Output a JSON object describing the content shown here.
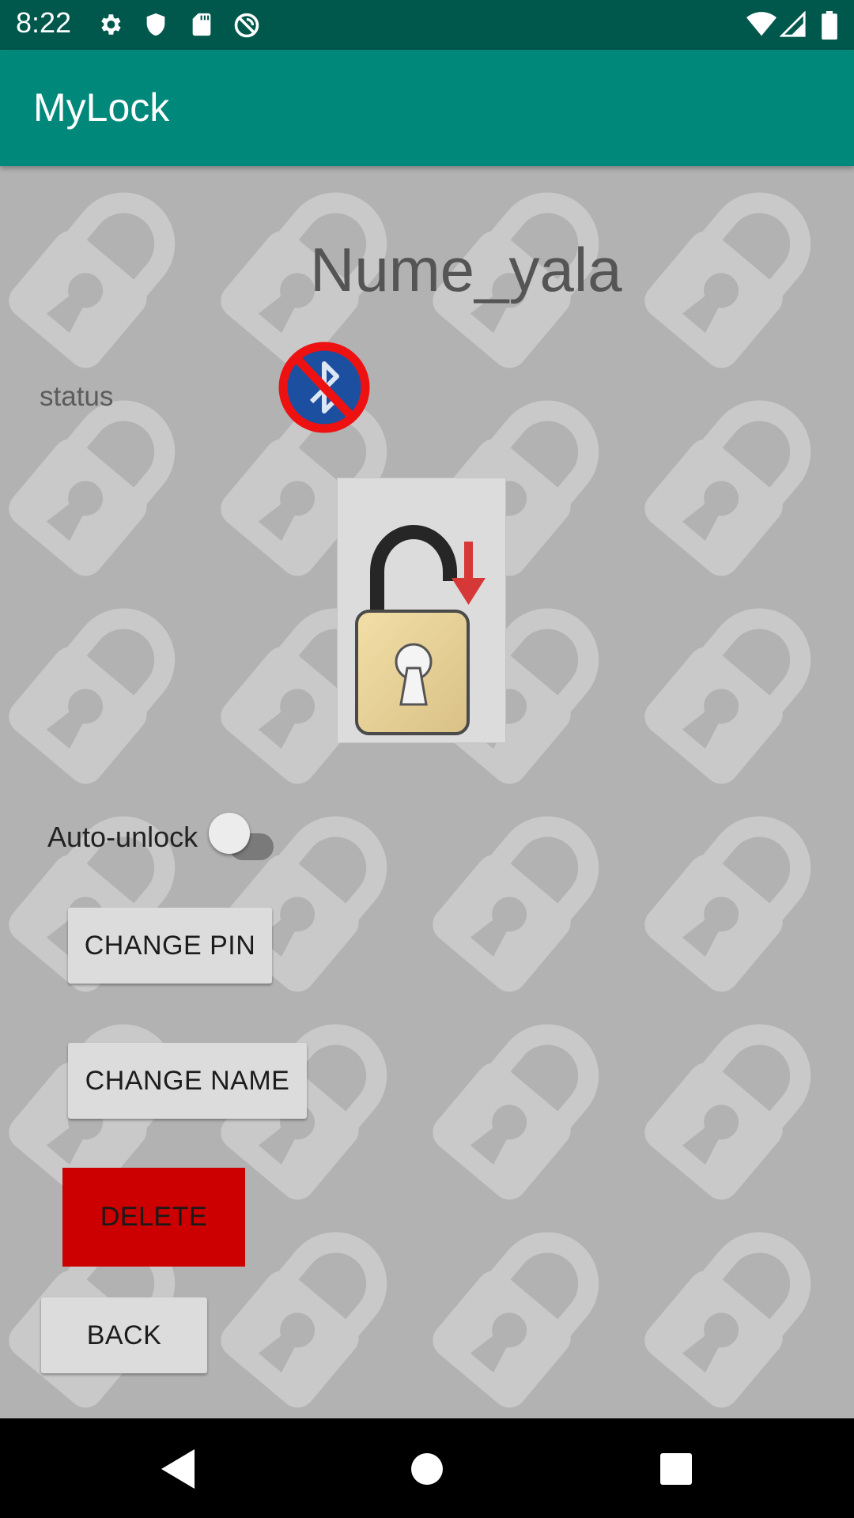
{
  "status_bar": {
    "time": "8:22",
    "icons": [
      "gear-icon",
      "shield-icon",
      "sd-card-icon",
      "sync-disabled-icon",
      "wifi-icon",
      "signal-icon",
      "battery-icon"
    ]
  },
  "app_bar": {
    "title": "MyLock"
  },
  "lock": {
    "name": "Nume_yala",
    "status_label": "status",
    "bluetooth_state_icon": "bluetooth-disabled-icon",
    "action_icon": "unlock-padlock-icon"
  },
  "auto_unlock": {
    "label": "Auto-unlock",
    "enabled": false
  },
  "buttons": {
    "change_pin": "CHANGE PIN",
    "change_name": "CHANGE NAME",
    "delete": "DELETE",
    "back": "BACK"
  },
  "colors": {
    "status_bar": "#00574b",
    "app_bar": "#00897b",
    "background": "#b2b2b2",
    "delete_button": "#cc0000"
  },
  "nav_bar": {
    "icons": [
      "back-icon",
      "home-icon",
      "recents-icon"
    ]
  }
}
